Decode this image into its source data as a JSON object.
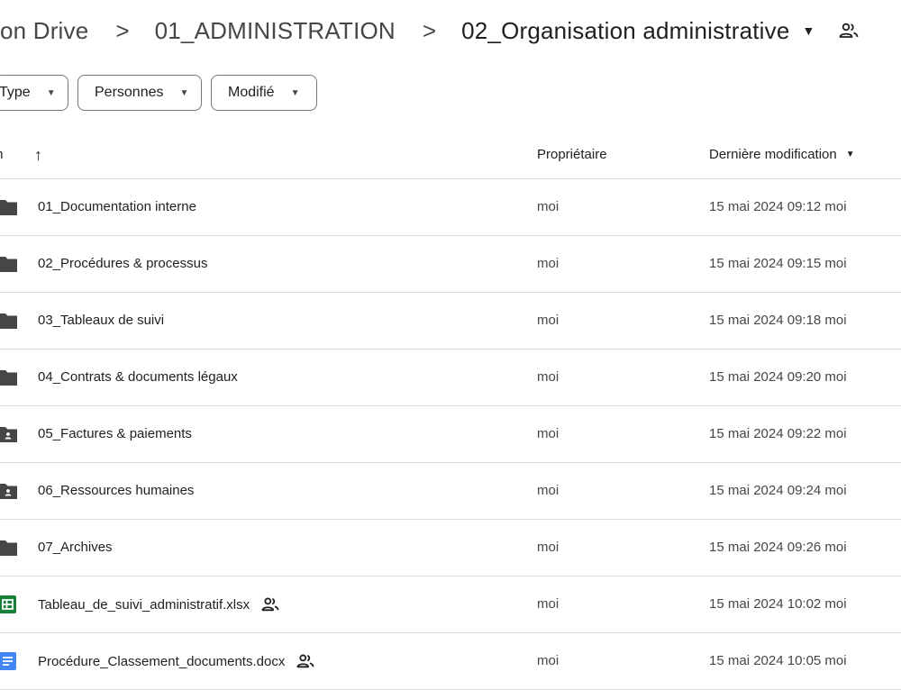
{
  "breadcrumb": {
    "items": [
      "lon Drive",
      "01_ADMINISTRATION",
      "02_Organisation administrative"
    ],
    "separator": ">",
    "current_icon": "shared-people-icon"
  },
  "filters": {
    "type": "Type",
    "persons": "Personnes",
    "modified": "Modifié"
  },
  "table": {
    "headers": {
      "name": "m",
      "owner": "Propriétaire",
      "modified": "Dernière modification"
    },
    "sort_icon": "arrow-up-icon",
    "rows": [
      {
        "name": "01_Documentation interne",
        "icon": "folder-icon",
        "shared": false,
        "owner": "moi",
        "modified": "15 mai 2024 09:12 moi"
      },
      {
        "name": "02_Procédures & processus",
        "icon": "folder-icon",
        "shared": false,
        "owner": "moi",
        "modified": "15 mai 2024 09:15 moi"
      },
      {
        "name": "03_Tableaux de suivi",
        "icon": "folder-icon",
        "shared": false,
        "owner": "moi",
        "modified": "15 mai 2024 09:18 moi"
      },
      {
        "name": "04_Contrats & documents légaux",
        "icon": "folder-icon",
        "shared": false,
        "owner": "moi",
        "modified": "15 mai 2024 09:20 moi"
      },
      {
        "name": "05_Factures & paiements",
        "icon": "shared-folder-icon",
        "shared": false,
        "owner": "moi",
        "modified": "15 mai 2024 09:22 moi"
      },
      {
        "name": "06_Ressources humaines",
        "icon": "shared-folder-icon",
        "shared": false,
        "owner": "moi",
        "modified": "15 mai 2024 09:24 moi"
      },
      {
        "name": "07_Archives",
        "icon": "folder-icon",
        "shared": false,
        "owner": "moi",
        "modified": "15 mai 2024 09:26 moi"
      },
      {
        "name": "Tableau_de_suivi_administratif.xlsx",
        "icon": "sheets-icon",
        "shared": true,
        "owner": "moi",
        "modified": "15 mai 2024 10:02 moi"
      },
      {
        "name": "Procédure_Classement_documents.docx",
        "icon": "docs-icon",
        "shared": true,
        "owner": "moi",
        "modified": "15 mai 2024 10:05 moi"
      }
    ]
  },
  "colors": {
    "folder": "#444746",
    "sheets": "#188038",
    "docs": "#4285f4",
    "divider": "#dadce0",
    "text_secondary": "#444746"
  }
}
